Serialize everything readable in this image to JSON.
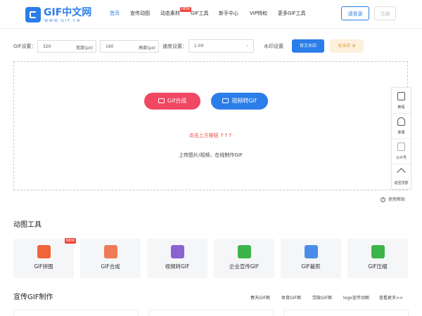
{
  "logo": {
    "name": "GIF中文网",
    "sub": "WWW.GIF.CN"
  },
  "nav": [
    {
      "label": "首页",
      "active": true
    },
    {
      "label": "宣传动图"
    },
    {
      "label": "动态素材",
      "badge": "NEW"
    },
    {
      "label": "GIF工具"
    },
    {
      "label": "新手中心"
    },
    {
      "label": "VIP特权"
    },
    {
      "label": "更多GIF工具"
    }
  ],
  "auth": {
    "login": "请登录",
    "register": "注册"
  },
  "settings": {
    "gif_label": "GIF设置：",
    "width_value": "320",
    "width_unit": "宽度(px)",
    "height_value": "160",
    "height_unit": "高度(px)",
    "speed_label": "速度设置：",
    "speed_value": "1.0X",
    "watermark_label": "水印设置",
    "official_watermark": "官方水印",
    "no_watermark": "无水印"
  },
  "upload": {
    "gif_compose_button": "Gif合成",
    "video_to_gif_button": "视频转Gif",
    "hint_red": "点击上方按钮 ↑↑↑",
    "hint": "上传图片/视频，在线制作GIF"
  },
  "sidebar": [
    "教程",
    "客服",
    "公众号",
    "返回顶部"
  ],
  "help": "使用帮助",
  "tools_section": {
    "title": "动图工具",
    "badge": "NEW",
    "items": [
      {
        "label": "GIF拼图",
        "icon": "puzzle-icon",
        "color": "#f0643a"
      },
      {
        "label": "GIF合成",
        "icon": "layers-icon",
        "color": "#f0643a"
      },
      {
        "label": "视频转GIF",
        "icon": "video-icon",
        "color": "#8a63d2"
      },
      {
        "label": "企业宣传GIF",
        "icon": "image-icon",
        "color": "#3bb54a"
      },
      {
        "label": "GIF裁剪",
        "icon": "crop-icon",
        "color": "#4a8de8"
      },
      {
        "label": "GIF压缩",
        "icon": "zip-icon",
        "color": "#3bb54a"
      }
    ]
  },
  "promo_section": {
    "title": "宣传GIF制作",
    "links": [
      "春天GIF图",
      "体育GIF图",
      "党政GIF图",
      "logo宣传动图",
      "查看更多>>"
    ]
  },
  "colors": {
    "brand": "#2b7de9",
    "pink": "#f04763",
    "red_hint": "#e8453c",
    "new_badge": "#f0453a"
  }
}
